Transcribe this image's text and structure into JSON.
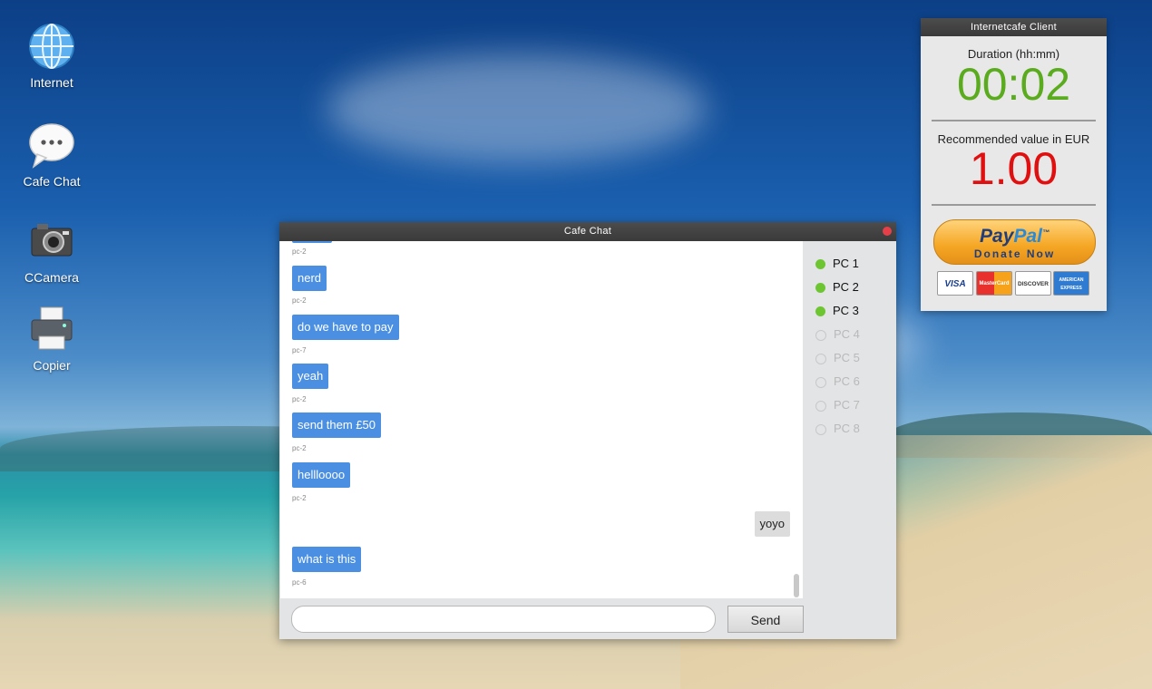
{
  "desktop": {
    "icons": [
      {
        "label": "Internet",
        "icon": "globe-icon"
      },
      {
        "label": "Cafe Chat",
        "icon": "chat-bubble-icon"
      },
      {
        "label": "CCamera",
        "icon": "camera-icon"
      },
      {
        "label": "Copier",
        "icon": "printer-icon"
      }
    ]
  },
  "chat": {
    "title": "Cafe Chat",
    "messages": [
      {
        "text": "nerd",
        "sender": "pc-2",
        "mine": false
      },
      {
        "text": "do we have to pay",
        "sender": "pc-7",
        "mine": false
      },
      {
        "text": "yeah",
        "sender": "pc-2",
        "mine": false
      },
      {
        "text": "send them £50",
        "sender": "pc-2",
        "mine": false
      },
      {
        "text": "hellloooo",
        "sender": "pc-2",
        "mine": false
      },
      {
        "text": "yoyo",
        "sender": "",
        "mine": true
      },
      {
        "text": "what is this",
        "sender": "pc-6",
        "mine": false
      }
    ],
    "top_sender": "pc-2",
    "input": {
      "value": "",
      "placeholder": ""
    },
    "send_label": "Send",
    "pcs": [
      {
        "label": "PC 1",
        "online": true
      },
      {
        "label": "PC 2",
        "online": true
      },
      {
        "label": "PC 3",
        "online": true
      },
      {
        "label": "PC 4",
        "online": false
      },
      {
        "label": "PC 5",
        "online": false
      },
      {
        "label": "PC 6",
        "online": false
      },
      {
        "label": "PC 7",
        "online": false
      },
      {
        "label": "PC 8",
        "online": false
      }
    ],
    "colors": {
      "my_bubble": "#dcdcdc",
      "other_bubble": "#4a8fe2",
      "online": "#6dc531"
    }
  },
  "client": {
    "title": "Internetcafe Client",
    "duration_label": "Duration (hh:mm)",
    "duration_value": "00:02",
    "recommended_label": "Recommended value in EUR",
    "recommended_value": "1.00",
    "paypal_brand_a": "Pay",
    "paypal_brand_b": "Pal",
    "paypal_tm": "™",
    "paypal_donate": "Donate Now",
    "cards": [
      "VISA",
      "MasterCard",
      "DISCOVER",
      "AMERICAN EXPRESS"
    ],
    "colors": {
      "duration": "#5aac1e",
      "recommended": "#e01010"
    }
  }
}
